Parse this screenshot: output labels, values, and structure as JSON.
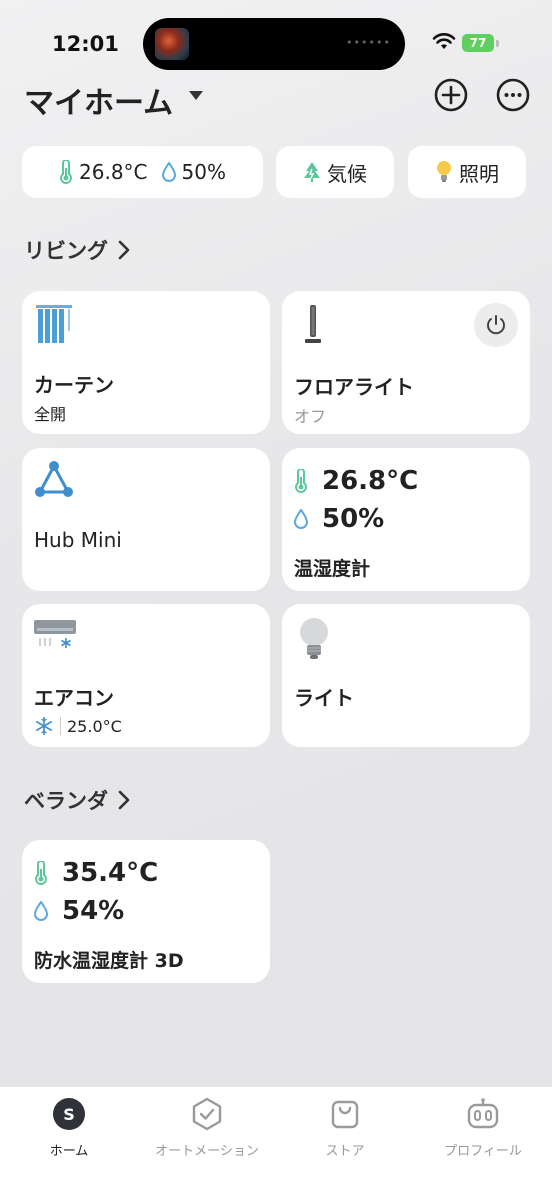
{
  "status_bar": {
    "time": "12:01",
    "battery": "77",
    "island_dots": "••••••"
  },
  "header": {
    "title": "マイホーム"
  },
  "chips": {
    "temperature": "26.8°C",
    "humidity": "50%",
    "climate_label": "気候",
    "lighting_label": "照明"
  },
  "sections": [
    {
      "title": "リビング"
    },
    {
      "title": "ベランダ"
    }
  ],
  "devices": {
    "curtain": {
      "name": "カーテン",
      "status": "全開"
    },
    "floor_light": {
      "name": "フロアライト",
      "status": "オフ"
    },
    "hub": {
      "name": "Hub Mini"
    },
    "thermo": {
      "name": "温湿度計",
      "temperature": "26.8°C",
      "humidity": "50%"
    },
    "aircon": {
      "name": "エアコン",
      "setting": "25.0°C"
    },
    "light": {
      "name": "ライト"
    },
    "outdoor_thermo": {
      "name": "防水温湿度計 3D",
      "temperature": "35.4°C",
      "humidity": "54%"
    }
  },
  "tab_bar": {
    "home_letter": "S",
    "items": [
      {
        "label": "ホーム"
      },
      {
        "label": "オートメーション"
      },
      {
        "label": "ストア"
      },
      {
        "label": "プロフィール"
      }
    ]
  },
  "colors": {
    "thermo_green": "#5cc79a",
    "drop_blue": "#5aa9e0",
    "curtain_blue": "#4a9fd8",
    "battery_green": "#5fcf5f"
  }
}
